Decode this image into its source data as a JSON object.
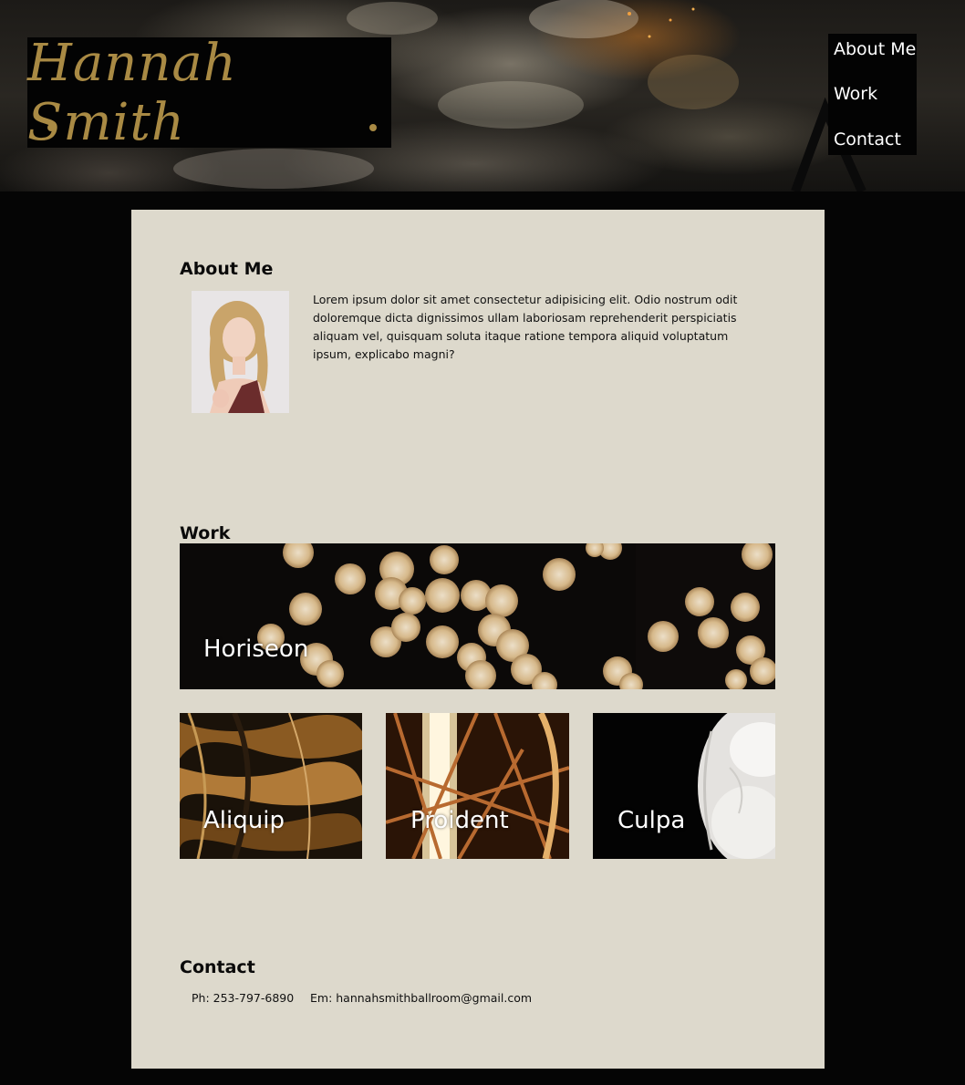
{
  "header": {
    "logo_text": "Hannah Smith",
    "nav": [
      "About Me",
      "Work",
      "Contact"
    ]
  },
  "about": {
    "heading": "About Me",
    "body": "Lorem ipsum dolor sit amet consectetur adipisicing elit. Odio nostrum odit doloremque dicta dignissimos ullam laboriosam reprehenderit perspiciatis aliquam vel, quisquam soluta itaque ratione tempora aliquid voluptatum ipsum, explicabo magni?"
  },
  "work": {
    "heading": "Work",
    "projects": [
      "Horiseon",
      "Aliquip",
      "Proident",
      "Culpa"
    ]
  },
  "contact": {
    "heading": "Contact",
    "phone": "Ph: 253-797-6890",
    "email": "Em: hannahsmithballroom@gmail.com"
  },
  "colors": {
    "page_bg": "#050505",
    "panel_bg": "#ddd9cc",
    "logo_gold": "#a98a44",
    "nav_bg": "#030303"
  }
}
